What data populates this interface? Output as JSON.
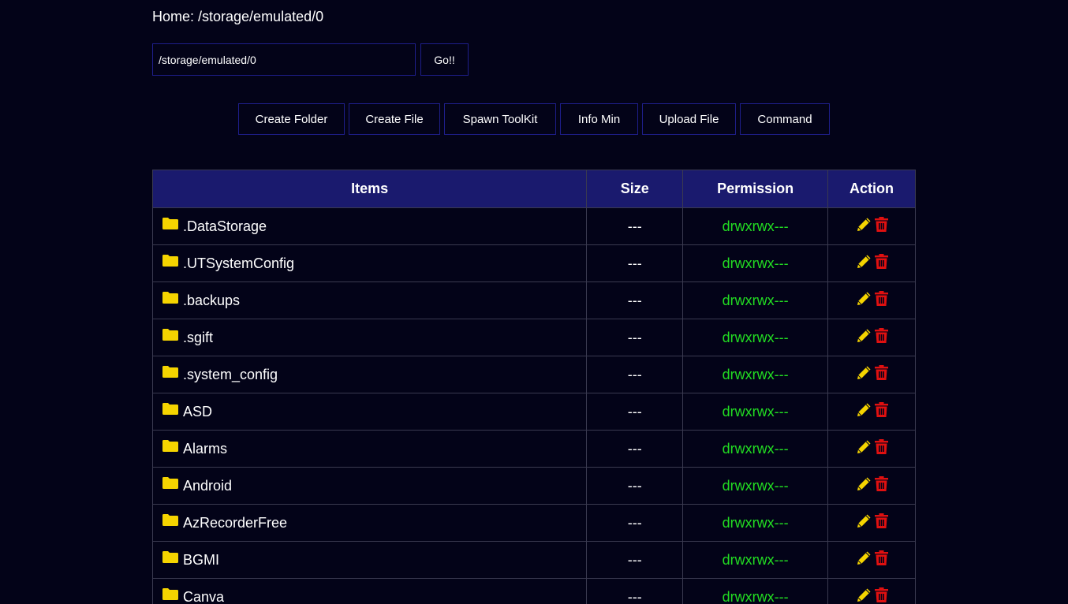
{
  "header": {
    "home_text": "Home: /storage/emulated/0"
  },
  "path_form": {
    "value": "/storage/emulated/0",
    "go_label": "Go!!"
  },
  "toolbar": [
    {
      "label": "Create Folder"
    },
    {
      "label": "Create File"
    },
    {
      "label": "Spawn ToolKit"
    },
    {
      "label": "Info Min"
    },
    {
      "label": "Upload File"
    },
    {
      "label": "Command"
    }
  ],
  "table": {
    "columns": [
      "Items",
      "Size",
      "Permission",
      "Action"
    ],
    "rows": [
      {
        "name": ".DataStorage",
        "size": "---",
        "permission": "drwxrwx---"
      },
      {
        "name": ".UTSystemConfig",
        "size": "---",
        "permission": "drwxrwx---"
      },
      {
        "name": ".backups",
        "size": "---",
        "permission": "drwxrwx---"
      },
      {
        "name": ".sgift",
        "size": "---",
        "permission": "drwxrwx---"
      },
      {
        "name": ".system_config",
        "size": "---",
        "permission": "drwxrwx---"
      },
      {
        "name": "ASD",
        "size": "---",
        "permission": "drwxrwx---"
      },
      {
        "name": "Alarms",
        "size": "---",
        "permission": "drwxrwx---"
      },
      {
        "name": "Android",
        "size": "---",
        "permission": "drwxrwx---"
      },
      {
        "name": "AzRecorderFree",
        "size": "---",
        "permission": "drwxrwx---"
      },
      {
        "name": "BGMI",
        "size": "---",
        "permission": "drwxrwx---"
      },
      {
        "name": "Canva",
        "size": "---",
        "permission": "drwxrwx---"
      }
    ],
    "row_icon": "folder-icon",
    "action_icons": [
      "pencil-icon",
      "trash-icon"
    ]
  },
  "colors": {
    "background": "#030318",
    "header_bg": "#1a1a6e",
    "permission": "#22dd22",
    "folder": "#f5d400",
    "edit": "#f5d400",
    "delete": "#e01010"
  }
}
